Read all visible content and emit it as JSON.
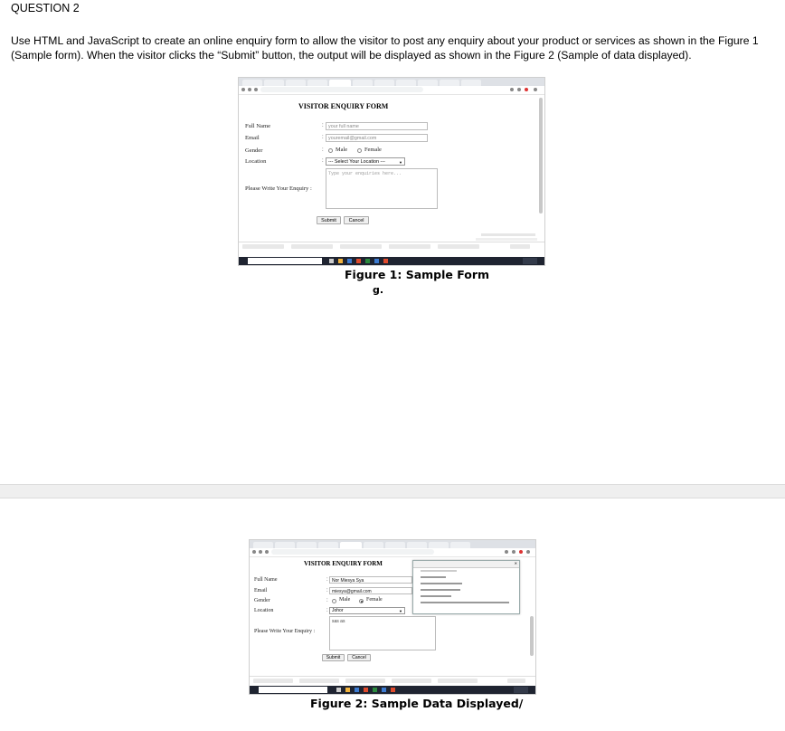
{
  "question": {
    "title": "QUESTION 2",
    "body": "Use HTML and JavaScript to create an online enquiry form to allow the visitor to post any enquiry about your product or services as shown in the Figure 1 (Sample form).  When the visitor clicks the “Submit” button, the output will be displayed as shown in the Figure 2 (Sample of data displayed)."
  },
  "figure1": {
    "caption": "Figure 1: Sample Form",
    "mark": "g.",
    "form": {
      "title": "VISITOR ENQUIRY FORM",
      "labels": {
        "full_name": "Full Name",
        "email": "Email",
        "gender": "Gender",
        "location": "Location",
        "enquiry": "Please Write Your Enquiry"
      },
      "placeholders": {
        "full_name": "your full name",
        "email": "youremail@gmail.com",
        "enquiry": "Type your enquiries here..."
      },
      "gender_options": {
        "male": "Male",
        "female": "Female"
      },
      "location_selected": "--- Select Your Location ---",
      "buttons": {
        "submit": "Submit",
        "cancel": "Cancel"
      }
    }
  },
  "figure2": {
    "caption": "Figure 2: Sample Data Displayed/",
    "form": {
      "title": "VISITOR ENQUIRY FORM",
      "labels": {
        "full_name": "Full Name",
        "email": "Email",
        "gender": "Gender",
        "location": "Location",
        "enquiry": "Please Write Your Enquiry"
      },
      "values": {
        "full_name": "Nor Miesya Sya",
        "email": "miesya@gmail.com",
        "location": "Johor",
        "enquiry": "sas as"
      },
      "gender_options": {
        "male": "Male",
        "female": "Female"
      },
      "gender_selected": "female",
      "buttons": {
        "submit": "Submit",
        "cancel": "Cancel"
      }
    }
  },
  "colors": {
    "taskbar": "#1f2431",
    "tab_bar": "#dee1e6",
    "page_gap": "#efefef"
  }
}
